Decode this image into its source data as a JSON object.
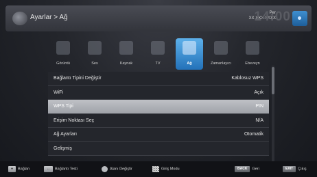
{
  "header": {
    "breadcrumb": "Ayarlar > Ağ",
    "day": "Per",
    "date": "XX XXX XXXX",
    "clock": "14:00"
  },
  "categories": [
    {
      "label": "Görüntü",
      "icon": "picture-icon"
    },
    {
      "label": "Ses",
      "icon": "sound-icon"
    },
    {
      "label": "Kaynak",
      "icon": "source-icon"
    },
    {
      "label": "TV",
      "icon": "tv-icon"
    },
    {
      "label": "Ağ",
      "icon": "network-icon",
      "active": true
    },
    {
      "label": "Zamanlayıcı",
      "icon": "timer-icon"
    },
    {
      "label": "Ebeveyn",
      "icon": "parental-icon"
    }
  ],
  "menu": [
    {
      "label": "Bağlantı Tipini Değiştir",
      "value": "Kablosuz WPS"
    },
    {
      "label": "WiFi",
      "value": "Açık"
    },
    {
      "label": "WPS Tipi",
      "value": "PIN",
      "selected": true
    },
    {
      "label": "Erişim Noktası Seç",
      "value": "N/A"
    },
    {
      "label": "Ağ Ayarları",
      "value": "Otomatik"
    },
    {
      "label": "Gelişmiş",
      "value": ""
    }
  ],
  "footer": {
    "connect": "Bağlan",
    "connection_test": "Bağlantı Testi",
    "change_area": "Alanı Değiştir",
    "input_mode": "Giriş Modu",
    "back_key": "BACK",
    "back": "Geri",
    "exit_key": "EXIT",
    "exit": "Çıkış"
  },
  "colors": {
    "accent": "#3f8fd0",
    "selected_row": "#aeb0b5"
  }
}
